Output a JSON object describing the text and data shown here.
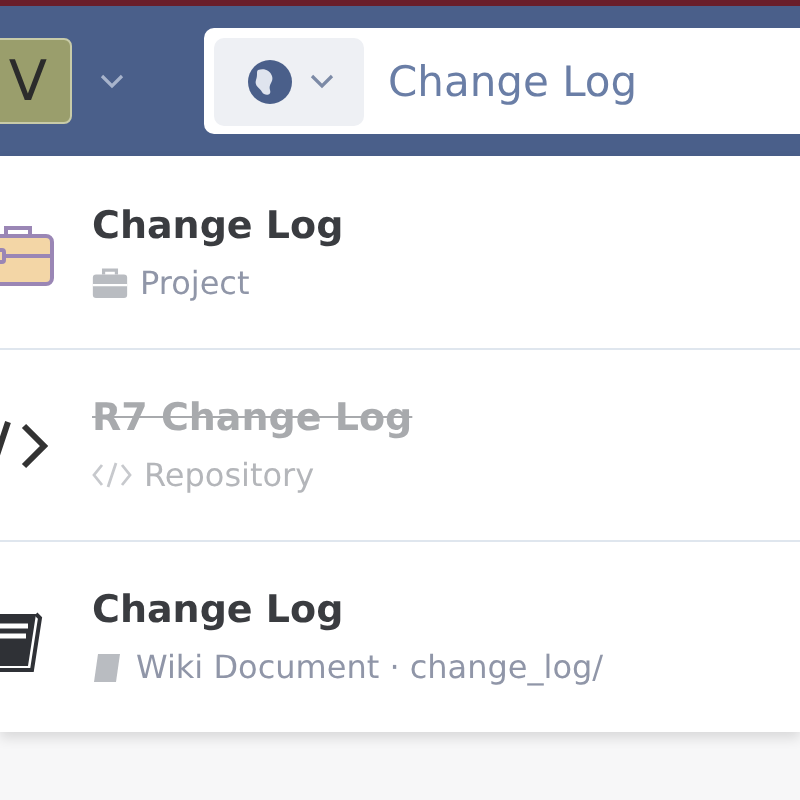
{
  "header": {
    "avatar": "V",
    "search": {
      "value": "Change Log"
    }
  },
  "results": [
    {
      "kind": "project",
      "title": "Change Log",
      "subtitle": "Project",
      "disabled": false
    },
    {
      "kind": "repository",
      "title": "R7 Change Log",
      "subtitle": "Repository",
      "disabled": true
    },
    {
      "kind": "wiki",
      "title": "Change Log",
      "subtitle": "Wiki Document · change_log/",
      "disabled": false
    }
  ]
}
